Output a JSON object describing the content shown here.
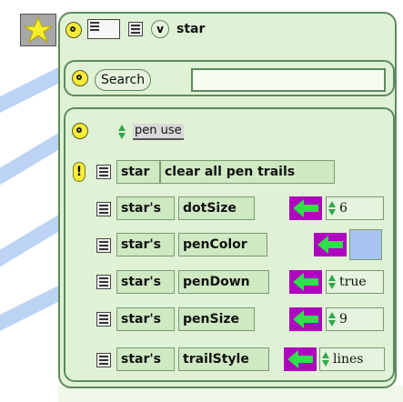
{
  "colors": {
    "viewer_bg": "#dff2d5",
    "viewer_border": "#5e8a5c",
    "tile_bg": "#cfe9c3",
    "arrow_bg": "#b000c0",
    "arrow_fg": "#2ee04a",
    "pen_color_value": "#a9c4f2",
    "background_stroke": "#bcd3f4"
  },
  "header": {
    "v_label": "v",
    "object_name": "star"
  },
  "search": {
    "button_label": "Search",
    "value": ""
  },
  "category": {
    "name": "pen use"
  },
  "command": {
    "exclamation": "!",
    "target": "star",
    "action": "clear all pen trails"
  },
  "rows": [
    {
      "owner": "star's",
      "property": "dotSize",
      "value": "6",
      "type": "number"
    },
    {
      "owner": "star's",
      "property": "penColor",
      "value": "",
      "type": "color"
    },
    {
      "owner": "star's",
      "property": "penDown",
      "value": "true",
      "type": "boolean"
    },
    {
      "owner": "star's",
      "property": "penSize",
      "value": "9",
      "type": "number"
    },
    {
      "owner": "star's",
      "property": "trailStyle",
      "value": "lines",
      "type": "symbol"
    }
  ]
}
